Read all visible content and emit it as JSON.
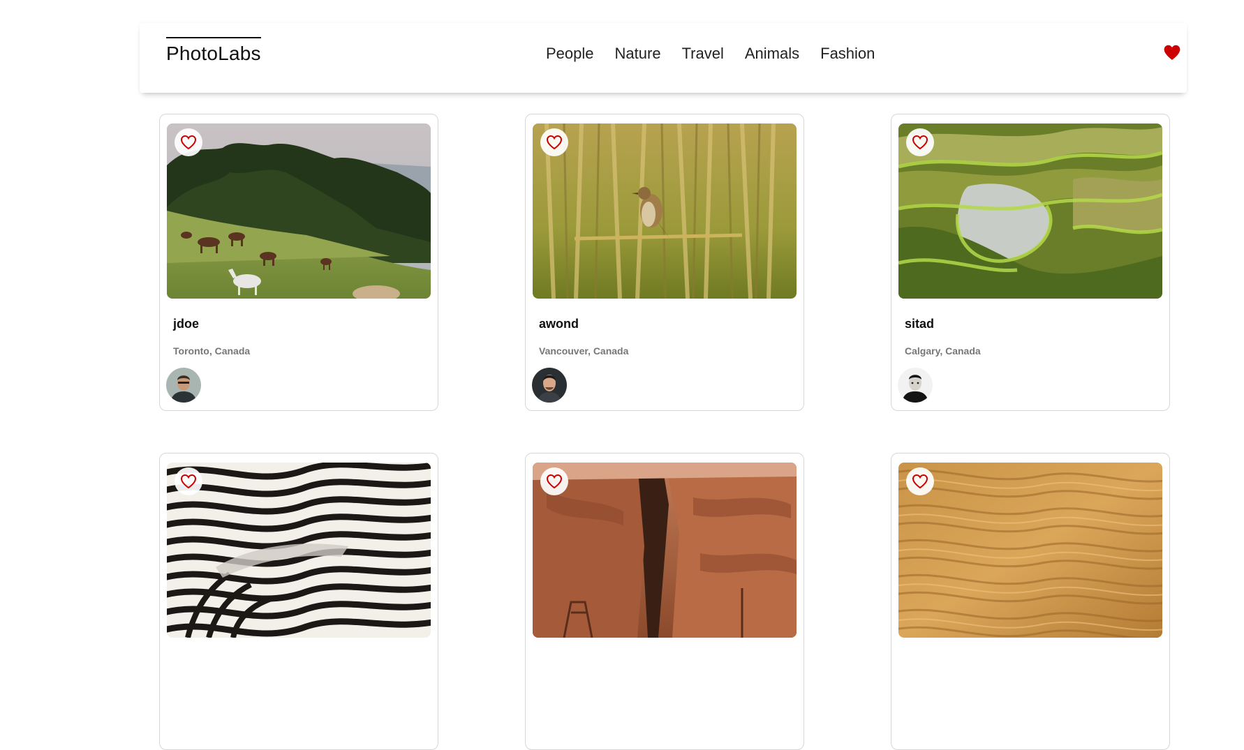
{
  "nav": {
    "logo": "PhotoLabs",
    "topics": [
      "People",
      "Nature",
      "Travel",
      "Animals",
      "Fashion"
    ],
    "fav_icon": "heart-filled-icon",
    "accent_color": "#cc0000"
  },
  "photos": [
    {
      "username": "jdoe",
      "location": "Toronto, Canada",
      "scene": "horses-meadow",
      "like_icon": "heart-outline-icon"
    },
    {
      "username": "awond",
      "location": "Vancouver, Canada",
      "scene": "bird-reeds",
      "like_icon": "heart-outline-icon"
    },
    {
      "username": "sitad",
      "location": "Calgary, Canada",
      "scene": "rice-terraces",
      "like_icon": "heart-outline-icon"
    },
    {
      "scene": "zebra-stripes",
      "like_icon": "heart-outline-icon"
    },
    {
      "scene": "canyon",
      "like_icon": "heart-outline-icon"
    },
    {
      "scene": "sand-dunes",
      "like_icon": "heart-outline-icon"
    }
  ]
}
